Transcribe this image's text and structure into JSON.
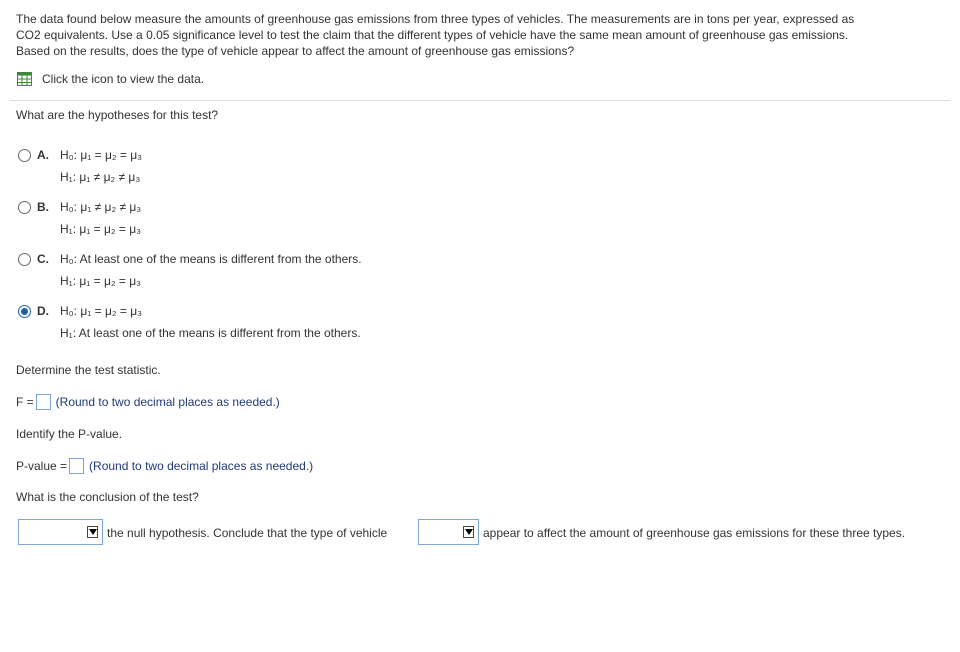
{
  "intro": {
    "line1": "The data found below measure the amounts of greenhouse gas emissions from three types of vehicles. The measurements are in tons per year, expressed as",
    "line2": "CO2 equivalents. Use a 0.05 significance level to test the claim that the different types of vehicle have the same mean amount of greenhouse gas emissions.",
    "line3": "Based on the results, does the type of vehicle appear to affect the amount of greenhouse gas emissions?"
  },
  "data_link": {
    "label": "Click the icon to view the data.",
    "icon": "table-grid-icon"
  },
  "q_hypotheses": "What are the hypotheses for this test?",
  "choices": [
    {
      "letter": "A.",
      "h0": "H₀: μ₁ = μ₂ = μ₃",
      "h1": "H₁: μ₁ ≠ μ₂ ≠ μ₃",
      "selected": false
    },
    {
      "letter": "B.",
      "h0": "H₀: μ₁ ≠ μ₂ ≠ μ₃",
      "h1": "H₁: μ₁ = μ₂ = μ₃",
      "selected": false
    },
    {
      "letter": "C.",
      "h0": "H₀: At least one of the means is different from the others.",
      "h1": "H₁: μ₁ = μ₂ = μ₃",
      "selected": false
    },
    {
      "letter": "D.",
      "h0": "H₀: μ₁ = μ₂ = μ₃",
      "h1": "H₁: At least one of the means is different from the others.",
      "selected": true
    }
  ],
  "q_statistic": "Determine the test statistic.",
  "f_row": {
    "label": "F =",
    "value": "",
    "hint": "(Round to two decimal places as needed.)"
  },
  "q_pvalue": "Identify the P-value.",
  "p_row": {
    "label": "P-value =",
    "value": "",
    "hint": "(Round to two decimal places as needed.)"
  },
  "q_conclusion": "What is the conclusion of the test?",
  "conclusion": {
    "select1_value": "",
    "text1": "the null hypothesis. Conclude that the type of vehicle",
    "select2_value": "",
    "text2": "appear to affect the amount of greenhouse gas emissions for these three types."
  },
  "colors": {
    "accent": "#1f5fa8",
    "hint": "#1f3a7a",
    "input_border": "#7fa6d3",
    "icon": "#3a8a3a"
  }
}
